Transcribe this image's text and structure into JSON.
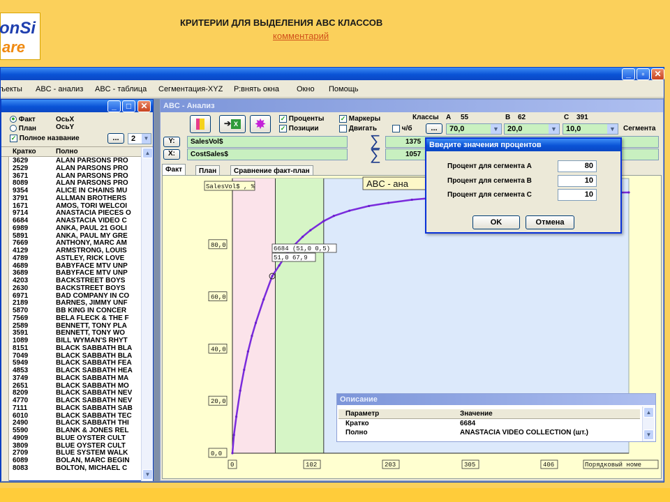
{
  "slide": {
    "logo_line1": "onSi",
    "logo_line2": "are",
    "title": "КРИТЕРИИ ДЛЯ ВЫДЕЛЕНИЯ ABC КЛАССОВ",
    "subtitle": "комментарий"
  },
  "app": {
    "menu": [
      "ъекты",
      "ABC - анализ",
      "ABC - таблица",
      "Сегментация-XYZ",
      "Р:внять окна",
      "Окно",
      "Помощь"
    ]
  },
  "left_panel": {
    "radio_fact": "Факт",
    "radio_plan": "План",
    "axis_x": "ОсьX",
    "axis_y": "ОсьY",
    "full_name_label": "Полное название",
    "dots_button": "...",
    "number_field": "2",
    "col_short": "Кратко",
    "col_full": "Полно",
    "rows": [
      [
        "3629",
        "ALAN PARSONS PRO"
      ],
      [
        "2529",
        "ALAN PARSONS PRO"
      ],
      [
        "3671",
        "ALAN PARSONS PRO"
      ],
      [
        "8089",
        "ALAN PARSONS PRO"
      ],
      [
        "9354",
        "ALICE IN CHAINS MU"
      ],
      [
        "3791",
        "ALLMAN BROTHERS"
      ],
      [
        "1671",
        "AMOS, TORI WELCOI"
      ],
      [
        "9714",
        "ANASTACIA PIECES O"
      ],
      [
        "6684",
        "ANASTACIA VIDEO C"
      ],
      [
        "6989",
        "ANKA, PAUL 21 GOLI"
      ],
      [
        "5891",
        "ANKA, PAUL MY GRE"
      ],
      [
        "7669",
        "ANTHONY, MARC AM"
      ],
      [
        "4129",
        "ARMSTRONG, LOUIS"
      ],
      [
        "4789",
        "ASTLEY, RICK LOVE"
      ],
      [
        "4689",
        "BABYFACE MTV UNP"
      ],
      [
        "3689",
        "BABYFACE MTV UNP"
      ],
      [
        "4203",
        "BACKSTREET BOYS"
      ],
      [
        "2630",
        "BACKSTREET BOYS"
      ],
      [
        "6971",
        "BAD COMPANY IN CO"
      ],
      [
        "2189",
        "BARNES, JIMMY UNF"
      ],
      [
        "5870",
        "BB KING IN CONCER"
      ],
      [
        "7569",
        "BELA FLECK & THE F"
      ],
      [
        "2589",
        "BENNETT, TONY PLA"
      ],
      [
        "3591",
        "BENNETT, TONY WO"
      ],
      [
        "1089",
        "BILL WYMAN'S RHYT"
      ],
      [
        "8151",
        "BLACK SABBATH BLA"
      ],
      [
        "7049",
        "BLACK SABBATH BLA"
      ],
      [
        "5949",
        "BLACK SABBATH FEA"
      ],
      [
        "4853",
        "BLACK SABBATH HEA"
      ],
      [
        "3749",
        "BLACK SABBATH MA"
      ],
      [
        "2651",
        "BLACK SABBATH MO"
      ],
      [
        "8209",
        "BLACK SABBATH NEV"
      ],
      [
        "4770",
        "BLACK SABBATH NEV"
      ],
      [
        "7111",
        "BLACK SABBATH SAB"
      ],
      [
        "6010",
        "BLACK SABBATH TEC"
      ],
      [
        "2490",
        "BLACK SABBATH THI"
      ],
      [
        "5590",
        "BLANK & JONES REL"
      ],
      [
        "4909",
        "BLUE OYSTER CULT"
      ],
      [
        "3809",
        "BLUE OYSTER CULT"
      ],
      [
        "2709",
        "BLUE SYSTEM WALK"
      ],
      [
        "6089",
        "BOLAN, MARC BEGIN"
      ],
      [
        "8083",
        "BOLTON, MICHAEL C"
      ]
    ]
  },
  "abc_window": {
    "title": "ABC - Анализ",
    "cb_percent": "Проценты",
    "cb_positions": "Позиции",
    "cb_markers": "Маркеры",
    "cb_move": "Двигать",
    "cb_bw": "ч/б",
    "classes_label": "Классы",
    "class_a": "A",
    "class_a_count": "55",
    "class_b": "B",
    "class_b_count": "62",
    "class_c": "C",
    "class_c_count": "391",
    "combo_a": "70,0",
    "combo_b": "20,0",
    "combo_c": "10,0",
    "segment_label": "Сегмента",
    "dots_button": "...",
    "y_btn": "Y:",
    "x_btn": "X:",
    "y_field": "SalesVol$",
    "x_field": "CostSales$",
    "sum_y": "1375",
    "sum_x": "1057",
    "tabs": [
      "Факт",
      "План",
      "Сравнение факт-план"
    ]
  },
  "chart_data": {
    "type": "line",
    "title": "ABC - ана",
    "ylabel": "SalesVol$ , %",
    "xlabel": "Порядковый номе",
    "xlim": [
      0,
      508
    ],
    "ylim": [
      0,
      100
    ],
    "x_ticks": [
      "0",
      "102",
      "203",
      "305",
      "406"
    ],
    "y_ticks": [
      "0,0",
      "20,0",
      "40,0",
      "60,0",
      "80,0"
    ],
    "boundaries": [
      55,
      117
    ],
    "series": [
      {
        "x": [
          0,
          2,
          5,
          10,
          15,
          20,
          25,
          30,
          40,
          51,
          60,
          70,
          80,
          90,
          100,
          117,
          130,
          150,
          175,
          200,
          230,
          260,
          300,
          340,
          380,
          420,
          460,
          508
        ],
        "y": [
          0,
          7,
          14,
          24,
          32,
          39,
          45,
          50,
          59,
          67.9,
          72,
          76.5,
          80,
          83,
          85.5,
          89,
          91,
          93,
          94.8,
          96,
          97.2,
          98,
          98.7,
          99.2,
          99.5,
          99.7,
          99.9,
          100
        ]
      }
    ],
    "annotations": [
      "6684 (51,0 0,5)",
      "51,0 67,9"
    ]
  },
  "dialog": {
    "title": "Введите значения процентов",
    "label_a": "Процент для сегмента A",
    "label_b": "Процент для сегмента B",
    "label_c": "Процент для сегмента C",
    "value_a": "80",
    "value_b": "10",
    "value_c": "10",
    "ok": "OK",
    "cancel": "Отмена"
  },
  "description": {
    "title": "Описание",
    "col_param": "Параметр",
    "col_value": "Значение",
    "row1_param": "Кратко",
    "row1_value": "6684",
    "row2_param": "Полно",
    "row2_value": "ANASTACIA VIDEO COLLECTION (шт.)"
  }
}
